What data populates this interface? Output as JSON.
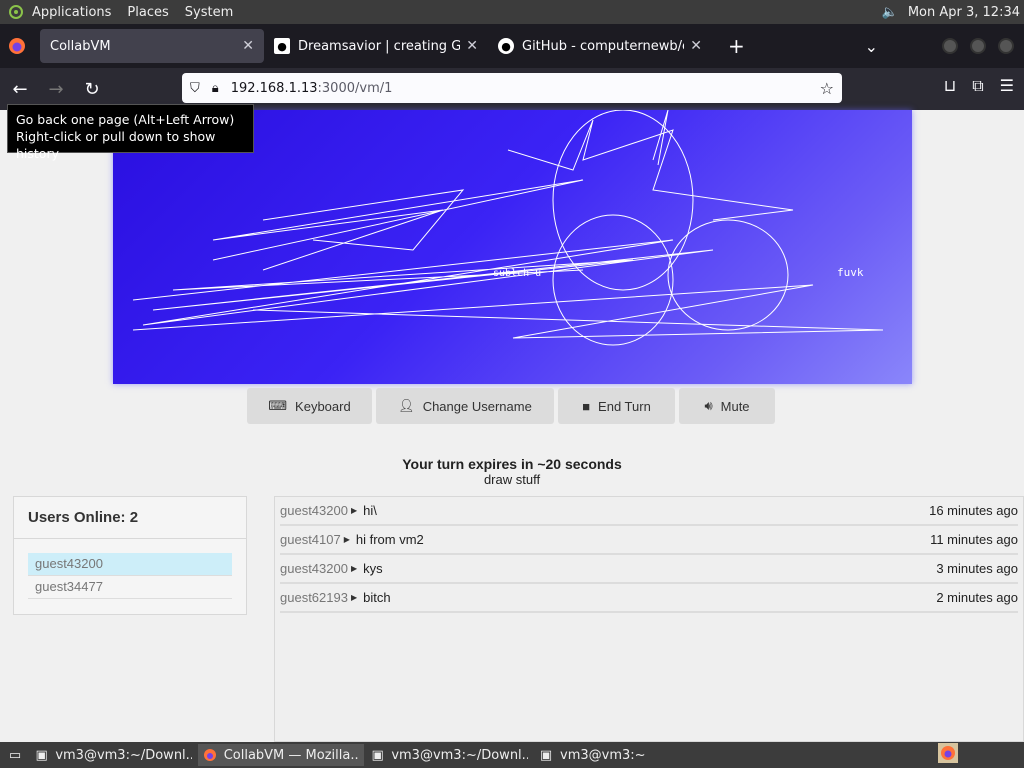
{
  "panel": {
    "menus": [
      "Applications",
      "Places",
      "System"
    ],
    "clock": "Mon Apr  3, 12:34"
  },
  "tabs": [
    {
      "title": "CollabVM",
      "active": true
    },
    {
      "title": "Dreamsavior | creating Gam",
      "active": false
    },
    {
      "title": "GitHub - computernewb/coll",
      "active": false
    }
  ],
  "url": {
    "host": "192.168.1.13",
    "path": ":3000/vm/1"
  },
  "tooltip": {
    "line1": "Go back one page (Alt+Left Arrow)",
    "line2": "Right-click or pull down to show history"
  },
  "vm": {
    "scribble_text1": "fuvk",
    "scribble_text2": "sublch u"
  },
  "toolbar": {
    "keyboard": "Keyboard",
    "change_username": "Change Username",
    "end_turn": "End Turn",
    "mute": "Mute"
  },
  "turn": {
    "status": "Your turn expires in ~20 seconds",
    "note": "draw stuff"
  },
  "users": {
    "header": "Users Online: 2",
    "list": [
      "guest43200",
      "guest34477"
    ]
  },
  "chat": [
    {
      "user": "guest43200",
      "message": "hi\\",
      "time": "16 minutes ago"
    },
    {
      "user": "guest4107",
      "message": "hi from vm2",
      "time": "11 minutes ago"
    },
    {
      "user": "guest43200",
      "message": "kys",
      "time": "3 minutes ago"
    },
    {
      "user": "guest62193",
      "message": "bitch",
      "time": "2 minutes ago"
    }
  ],
  "taskbar": [
    {
      "label": "vm3@vm3:~/Downl...",
      "icon": "terminal-icon",
      "active": false
    },
    {
      "label": "CollabVM — Mozilla...",
      "icon": "firefox-icon",
      "active": true
    },
    {
      "label": "vm3@vm3:~/Downl...",
      "icon": "terminal-icon",
      "active": false
    },
    {
      "label": "vm3@vm3:~",
      "icon": "terminal-icon",
      "active": false
    }
  ]
}
